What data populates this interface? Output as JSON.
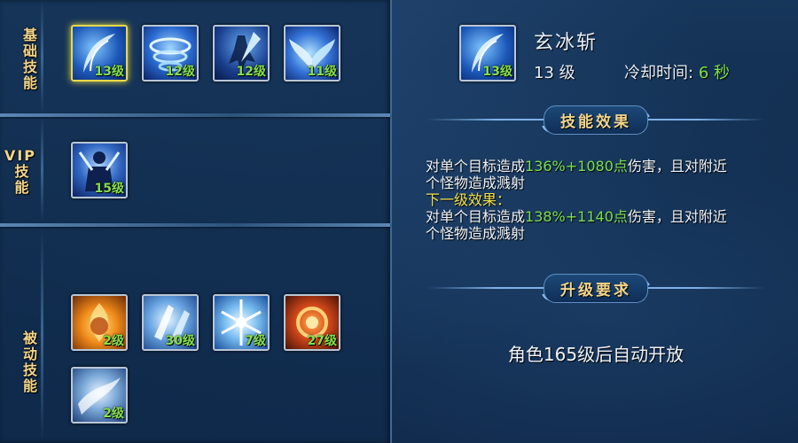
{
  "sections": {
    "basic": {
      "label": "基础技能"
    },
    "vip": {
      "label_top": "VIP",
      "label_bottom": "技能"
    },
    "passive": {
      "label": "被动技能"
    }
  },
  "basic_skills": [
    {
      "name": "ice-slash",
      "level": "13级",
      "selected": true
    },
    {
      "name": "ice-vortex",
      "level": "12级"
    },
    {
      "name": "ice-strike",
      "level": "12级"
    },
    {
      "name": "ice-wings",
      "level": "11级"
    }
  ],
  "vip_skills": [
    {
      "name": "ice-avatar",
      "level": "15级"
    }
  ],
  "passive_skills": [
    {
      "name": "fire-aura",
      "level": "2级"
    },
    {
      "name": "ice-shards",
      "level": "30级"
    },
    {
      "name": "ice-crystal",
      "level": "7级"
    },
    {
      "name": "fire-burst",
      "level": "27级"
    },
    {
      "name": "ice-storm",
      "level": "2级"
    }
  ],
  "detail": {
    "icon_level": "13级",
    "name": "玄冰斩",
    "level": "13 级",
    "cooldown_label": "冷却时间:",
    "cooldown_value": "6 秒",
    "effect_title": "技能效果",
    "effect_prefix": "对单个目标造成",
    "effect_value": "136%+1080点",
    "effect_suffix": "伤害，且对附近",
    "effect_line2": "个怪物造成溅射",
    "next_label": "下一级效果：",
    "next_prefix": "对单个目标造成",
    "next_value": "138%+1140点",
    "next_suffix": "伤害，且对附近",
    "next_line2": "个怪物造成溅射",
    "upgrade_title": "升级要求",
    "upgrade_text": "角色165级后自动开放"
  },
  "colors": {
    "accent_gold": "#f2d58a",
    "level_green": "#84e04a",
    "highlight_yellow": "#f2e14a",
    "selected_border": "#e8d94a"
  }
}
